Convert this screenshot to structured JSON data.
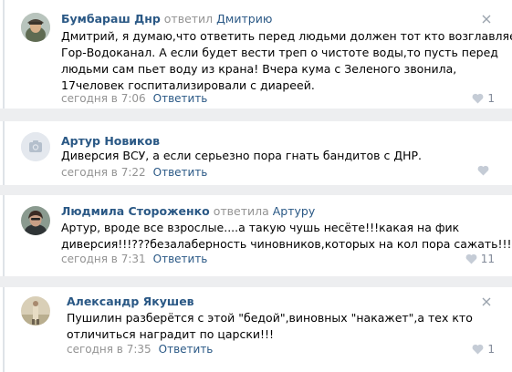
{
  "comments": [
    {
      "author": "Бумбараш Днр",
      "reply_word": "ответил",
      "reply_to": "Дмитрию",
      "lines": [
        "Дмитрий, я думаю,что ответить перед людьми должен тот кто возглавляет",
        "Гор-Водоканал. А если будет вести треп о чистоте воды,то пусть перед",
        "людьми сам пьет воду из крана! Вчера кума с Зеленого звонила,",
        "17человек госпитализировали с диареей."
      ],
      "time": "сегодня в 7:06",
      "reply_label": "Ответить",
      "likes": "1",
      "avatar": "photo-man-hat"
    },
    {
      "author": "Артур Новиков",
      "reply_word": "",
      "reply_to": "",
      "lines": [
        "Диверсия ВСУ, а если серьезно пора гнать бандитов с ДНР."
      ],
      "time": "сегодня в 7:22",
      "reply_label": "Ответить",
      "likes": "",
      "avatar": "camera-placeholder"
    },
    {
      "author": "Людмила Стороженко",
      "reply_word": "ответила",
      "reply_to": "Артуру",
      "lines": [
        "Артур, вроде все взрослые....а такую чушь несёте!!!какая на фик",
        "диверсия!!!???безалаберность чиновников,которых на кол пора сажать!!!!"
      ],
      "time": "сегодня в 7:31",
      "reply_label": "Ответить",
      "likes": "11",
      "avatar": "photo-woman"
    },
    {
      "author": "Александр Якушев",
      "reply_word": "",
      "reply_to": "",
      "lines": [
        "Пушилин разберётся с этой \"бедой\",виновных \"накажет\",а тех кто",
        "отличиться наградит по царски!!!"
      ],
      "time": "сегодня в 7:35",
      "reply_label": "Ответить",
      "likes": "1",
      "avatar": "photo-man-standing"
    }
  ],
  "colors": {
    "link": "#2a5885",
    "muted": "#939393",
    "gap": "#edeef0"
  }
}
